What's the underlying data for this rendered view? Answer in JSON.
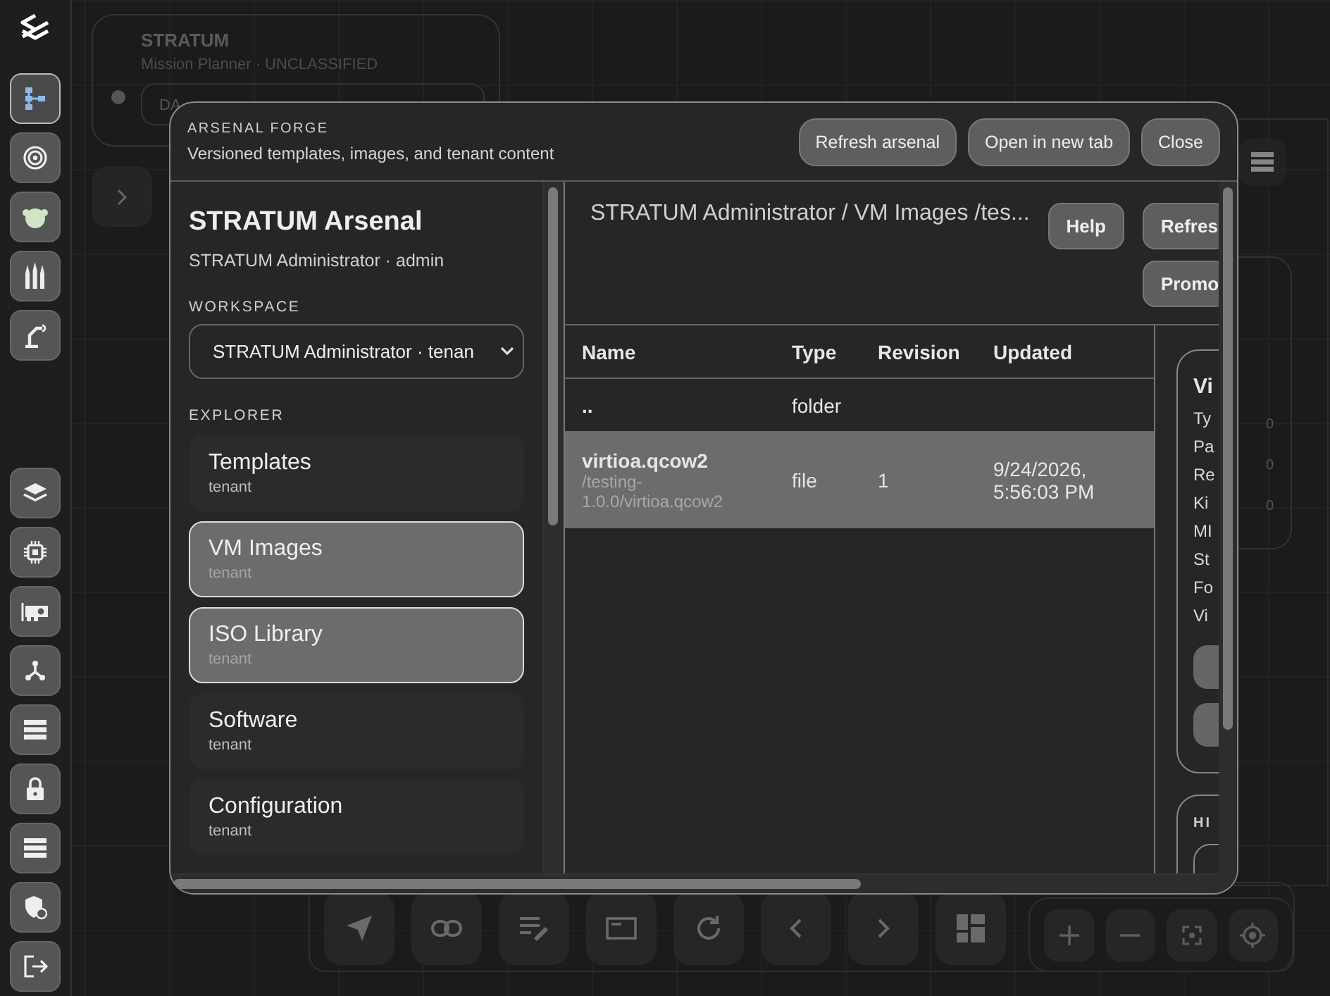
{
  "rail_top": [
    {
      "kind": "flow",
      "selected": true
    },
    {
      "kind": "target",
      "selected": false
    },
    {
      "kind": "head",
      "selected": false
    },
    {
      "kind": "ammo",
      "selected": false
    },
    {
      "kind": "arm",
      "selected": false
    }
  ],
  "rail_bottom": [
    {
      "kind": "layers"
    },
    {
      "kind": "chip"
    },
    {
      "kind": "card"
    },
    {
      "kind": "fork"
    },
    {
      "kind": "servers"
    },
    {
      "kind": "lock"
    },
    {
      "kind": "servers"
    },
    {
      "kind": "shield"
    },
    {
      "kind": "logout"
    }
  ],
  "project_card": {
    "title": "STRATUM",
    "subtitle": "Mission Planner · UNCLASSIFIED",
    "field": "DA"
  },
  "stats_card": {
    "values": [
      "0",
      "0",
      "0"
    ]
  },
  "toolbar": [
    {
      "kind": "navigate"
    },
    {
      "kind": "link"
    },
    {
      "kind": "edit"
    },
    {
      "kind": "window"
    },
    {
      "kind": "refresh"
    },
    {
      "kind": "prev"
    },
    {
      "kind": "next"
    },
    {
      "kind": "dashboard"
    }
  ],
  "zoom_controls": [
    {
      "kind": "plus"
    },
    {
      "kind": "minus"
    },
    {
      "kind": "fit"
    },
    {
      "kind": "locate"
    }
  ],
  "modal": {
    "eyebrow": "ARSENAL FORGE",
    "subtitle": "Versioned templates, images, and tenant content",
    "buttons": [
      "Refresh arsenal",
      "Open in new tab",
      "Close"
    ],
    "sidebar": {
      "title": "STRATUM Arsenal",
      "user": "STRATUM Administrator · admin",
      "workspace_label": "WORKSPACE",
      "workspace_value": "STRATUM Administrator · tenan",
      "explorer_label": "EXPLORER",
      "items": [
        {
          "label": "Templates",
          "scope": "tenant",
          "selected": false
        },
        {
          "label": "VM Images",
          "scope": "tenant",
          "selected": true
        },
        {
          "label": "ISO Library",
          "scope": "tenant",
          "selected": true
        },
        {
          "label": "Software",
          "scope": "tenant",
          "selected": false
        },
        {
          "label": "Configuration",
          "scope": "tenant",
          "selected": false
        }
      ]
    },
    "breadcrumb": "STRATUM Administrator / VM Images /tes...",
    "help_button": "Help",
    "action_buttons": [
      "Refres",
      "Promo"
    ],
    "table": {
      "columns": [
        "Name",
        "Type",
        "Revision",
        "Updated"
      ],
      "rows": [
        {
          "name": "..",
          "type": "folder",
          "selected": false
        },
        {
          "name": "virtioa.qcow2",
          "path": "/testing-1.0.0/virtioa.qcow2",
          "type": "file",
          "revision": "1",
          "updated": "9/24/2026, 5:56:03 PM",
          "selected": true
        }
      ]
    },
    "details": {
      "title": "Vi",
      "fields": [
        "Ty",
        "Pa",
        "Re",
        "Ki",
        "MI",
        "St",
        "Fo",
        "Vi"
      ],
      "section_title": "HI"
    }
  }
}
